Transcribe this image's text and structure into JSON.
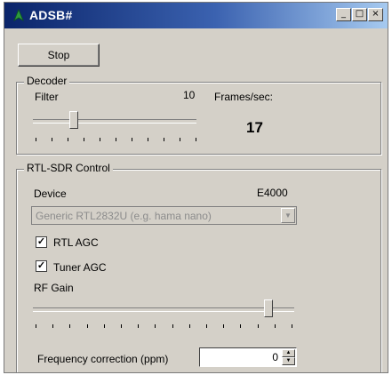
{
  "window": {
    "title": "ADSB#"
  },
  "titlebar_buttons": {
    "minimize": "_",
    "maximize": "□",
    "close": "×"
  },
  "toolbar": {
    "stop_label": "Stop"
  },
  "decoder": {
    "group_label": "Decoder",
    "filter_label": "Filter",
    "filter_value": "10",
    "filter_slider_fraction": 0.25,
    "frames_label": "Frames/sec:",
    "frames_value": "17"
  },
  "rtl_sdr": {
    "group_label": "RTL-SDR Control",
    "device_label": "Device",
    "tuner_name": "E4000",
    "device_selected": "Generic RTL2832U (e.g. hama nano)",
    "rtl_agc": {
      "label": "RTL AGC",
      "checked": true,
      "mark": "✓"
    },
    "tuner_agc": {
      "label": "Tuner AGC",
      "checked": true,
      "mark": "✓"
    },
    "rf_gain_label": "RF Gain",
    "rf_gain_slider_fraction": 0.9,
    "freq_correction_label": "Frequency correction (ppm)",
    "freq_correction_value": "0"
  },
  "colors": {
    "window_bg": "#d4d0c8",
    "titlebar": "#0a246a"
  }
}
